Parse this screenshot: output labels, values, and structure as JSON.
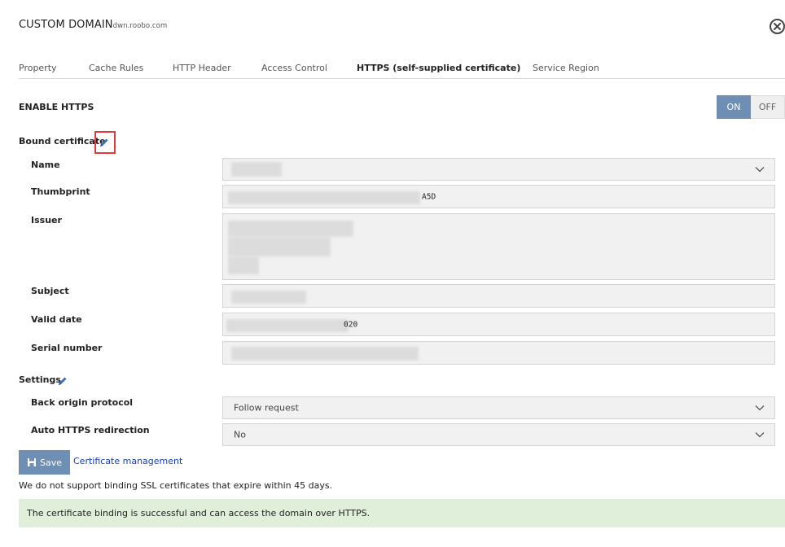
{
  "header": {
    "title": "CUSTOM DOMAIN",
    "domain": "dwn.roobo.com",
    "close_icon": "close-circle-icon"
  },
  "tabs": [
    {
      "label": "Property",
      "active": false
    },
    {
      "label": "Cache Rules",
      "active": false
    },
    {
      "label": "HTTP Header",
      "active": false
    },
    {
      "label": "Access Control",
      "active": false
    },
    {
      "label": "HTTPS (self-supplied certificate)",
      "active": true
    },
    {
      "label": "Service Region",
      "active": false
    }
  ],
  "https": {
    "label": "ENABLE HTTPS",
    "toggle_on": "ON",
    "toggle_off": "OFF",
    "state": "ON",
    "accent_color": "#6e8fb3"
  },
  "certificate": {
    "label": "Bound certificate",
    "edit_icon": "pencil-icon",
    "fields": {
      "name_label": "Name",
      "name_value": "",
      "thumbprint_label": "Thumbprint",
      "thumbprint_value": "A5D",
      "issuer_label": "Issuer",
      "issuer_value": "",
      "subject_label": "Subject",
      "subject_value": "",
      "valid_date_label": "Valid date",
      "valid_date_value": "020",
      "serial_label": "Serial number",
      "serial_value": ""
    }
  },
  "settings": {
    "label": "Settings",
    "edit_icon": "pencil-icon",
    "back_origin_label": "Back origin protocol",
    "back_origin_value": "Follow request",
    "auto_redirect_label": "Auto HTTPS redirection",
    "auto_redirect_value": "No"
  },
  "actions": {
    "save_label": "Save",
    "save_icon": "save-icon",
    "cert_mgmt_link": "Certificate management"
  },
  "messages": {
    "note": "We do not support binding SSL certificates that expire within 45 days.",
    "success": "The certificate binding is successful and can access the domain over HTTPS.",
    "success_color": "#dfefd9"
  }
}
